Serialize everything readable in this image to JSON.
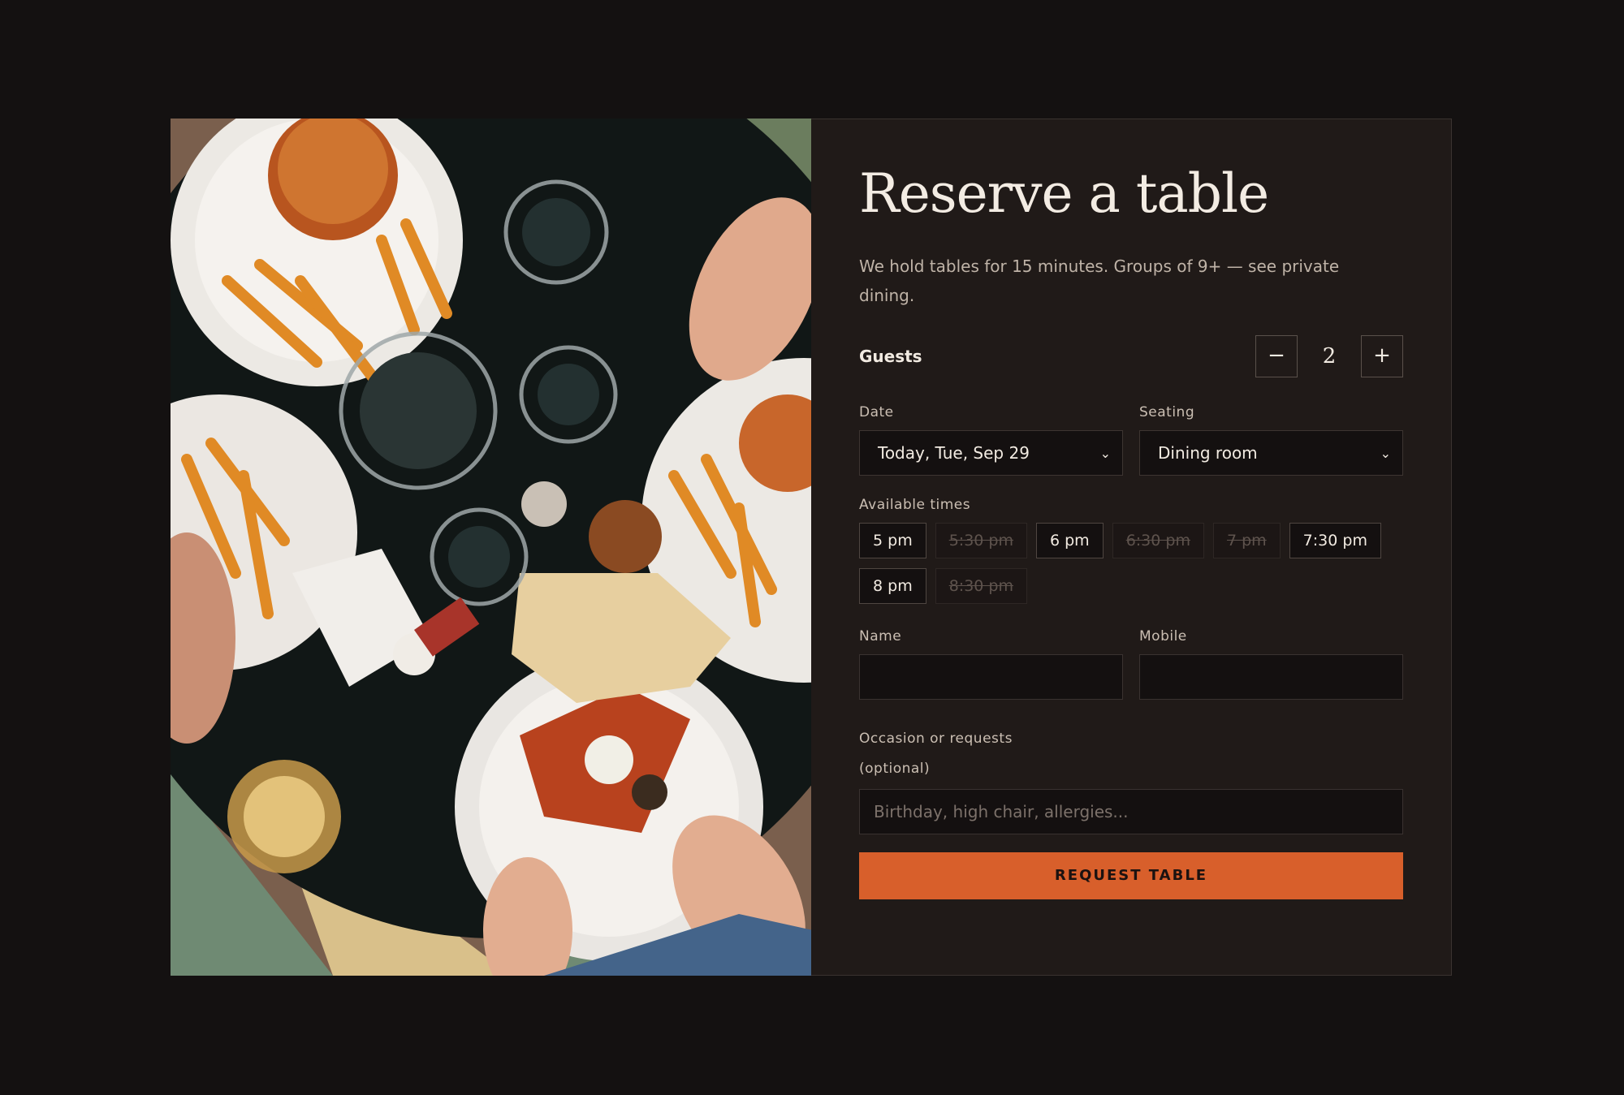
{
  "colors": {
    "accent": "#d85f2b",
    "panel": "#201a18",
    "background": "#141111"
  },
  "photo": {
    "alt_icon": "restaurant-table-photo"
  },
  "reservation": {
    "title": "Reserve a table",
    "intro": "We hold tables for 15 minutes. Groups of 9+ — see private dining.",
    "guests": {
      "label": "Guests",
      "decrement": "−",
      "value": "2",
      "increment": "+"
    },
    "date": {
      "label": "Date",
      "value": "Today, Tue, Sep 29"
    },
    "seating": {
      "label": "Seating",
      "value": "Dining room"
    },
    "times_label": "Available times",
    "times": [
      {
        "label": "5 pm",
        "available": true
      },
      {
        "label": "5:30 pm",
        "available": false
      },
      {
        "label": "6 pm",
        "available": true
      },
      {
        "label": "6:30 pm",
        "available": false
      },
      {
        "label": "7 pm",
        "available": false
      },
      {
        "label": "7:30 pm",
        "available": true
      },
      {
        "label": "8 pm",
        "available": true
      },
      {
        "label": "8:30 pm",
        "available": false
      }
    ],
    "name": {
      "label": "Name",
      "value": ""
    },
    "mobile": {
      "label": "Mobile",
      "value": ""
    },
    "occasion": {
      "label": "Occasion or requests",
      "hint": "(optional)",
      "placeholder": "Birthday, high chair, allergies..."
    },
    "submit": "REQUEST TABLE"
  }
}
